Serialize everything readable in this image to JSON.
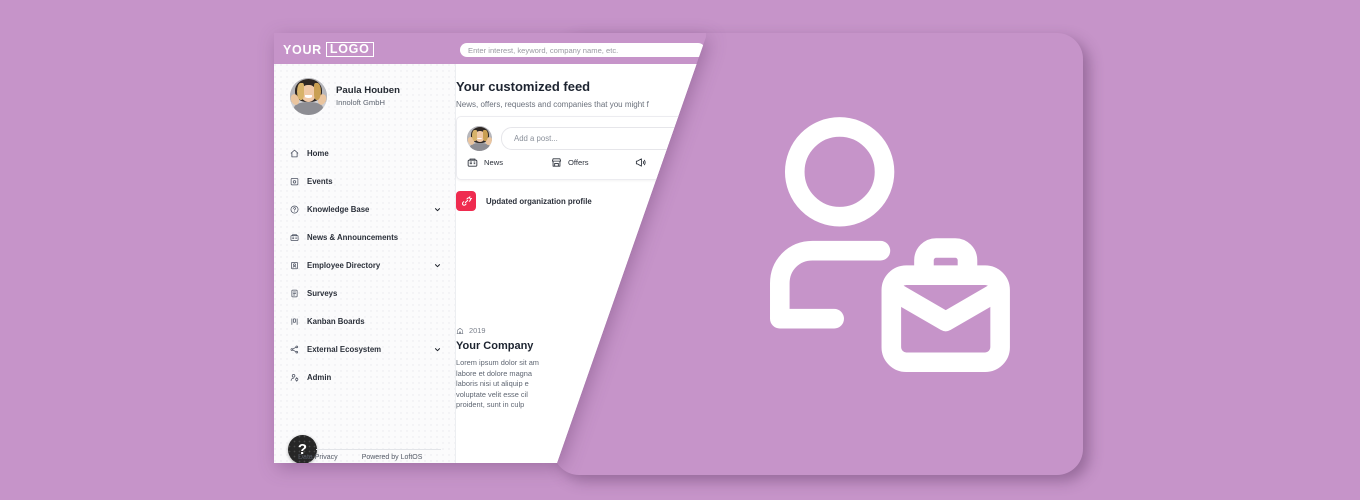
{
  "page": {
    "background_color": "#c694c9",
    "accent_white": "#ffffff"
  },
  "right_panel": {
    "hero_icon": "person-with-briefcase-icon"
  },
  "topbar": {
    "logo_word": "YOUR",
    "logo_boxed_word": "LOGO",
    "search": {
      "placeholder": "Enter interest, keyword, company name, etc.",
      "value": ""
    }
  },
  "sidebar": {
    "profile": {
      "avatar": "user-avatar",
      "name": "Paula Houben",
      "organization": "Innoloft GmbH"
    },
    "items": [
      {
        "label": "Home",
        "icon": "home-icon",
        "expandable": false
      },
      {
        "label": "Events",
        "icon": "calendar-icon",
        "expandable": false
      },
      {
        "label": "Knowledge Base",
        "icon": "book-icon",
        "expandable": true
      },
      {
        "label": "News & Announcements",
        "icon": "newspaper-icon",
        "expandable": false
      },
      {
        "label": "Employee Directory",
        "icon": "people-icon",
        "expandable": true
      },
      {
        "label": "Surveys",
        "icon": "clipboard-icon",
        "expandable": false
      },
      {
        "label": "Kanban Boards",
        "icon": "kanban-icon",
        "expandable": false
      },
      {
        "label": "External Ecosystem",
        "icon": "network-icon",
        "expandable": true
      },
      {
        "label": "Admin",
        "icon": "user-settings-icon",
        "expandable": false
      }
    ],
    "help_button_label": "?",
    "footer": {
      "data_privacy": "Data Privacy",
      "powered_by": "Powered by LoftOS"
    }
  },
  "main": {
    "title": "Your customized feed",
    "subtitle": "News, offers, requests and companies that you might f",
    "composer": {
      "avatar": "user-avatar",
      "placeholder": "Add a post...",
      "actions": [
        {
          "label": "News",
          "icon": "newspaper-icon"
        },
        {
          "label": "Offers",
          "icon": "store-icon"
        },
        {
          "label": "",
          "icon": "megaphone-icon"
        }
      ]
    },
    "update_row": {
      "badge_icon": "broken-link-icon",
      "badge_color": "#ef2b4f",
      "text": "Updated organization profile"
    },
    "company_card": {
      "year_icon": "company-icon",
      "year": "2019",
      "name": "Your Company",
      "body_lines": [
        "Lorem ipsum dolor sit am",
        "labore et dolore magna",
        "laboris nisi ut aliquip e",
        "voluptate velit esse cil",
        "proident, sunt in culp"
      ]
    }
  }
}
